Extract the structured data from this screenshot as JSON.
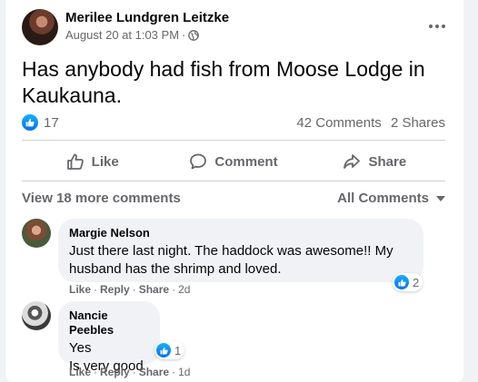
{
  "post": {
    "author": "Merilee Lundgren Leitzke",
    "date": "August 20 at 1:03 PM",
    "separator": "·",
    "text": "Has anybody had fish from Moose Lodge in Kaukauna.",
    "reactions_count": "17",
    "comments_count": "42 Comments",
    "shares_count": "2 Shares"
  },
  "actions": {
    "like": "Like",
    "comment": "Comment",
    "share": "Share"
  },
  "comments_bar": {
    "view_more": "View 18 more comments",
    "sort": "All Comments"
  },
  "comments": [
    {
      "name": "Margie Nelson",
      "text_lines": [
        "Just there last night. The haddock was awesome!! My",
        "husband has the shrimp and loved."
      ],
      "reactions": "2",
      "like": "Like",
      "reply": "Reply",
      "share": "Share",
      "time": "2d"
    },
    {
      "name": "Nancie Peebles",
      "text_lines": [
        "Yes",
        "Is very good"
      ],
      "reactions": "1",
      "like": "Like",
      "reply": "Reply",
      "share": "Share",
      "time": "1d"
    }
  ],
  "colors": {
    "accent": "#1877f2",
    "secondary_text": "#65676b",
    "bubble": "#f0f2f5"
  },
  "icons": [
    "more-icon",
    "globe-icon",
    "like-reaction-icon",
    "thumbs-up-icon",
    "comment-icon",
    "share-icon",
    "caret-down-icon"
  ]
}
